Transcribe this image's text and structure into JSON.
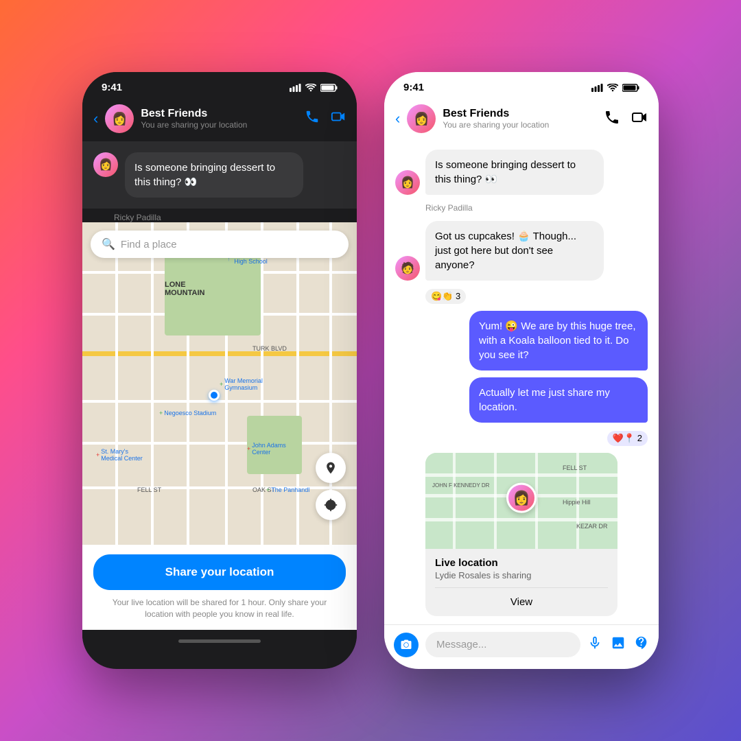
{
  "background": "gradient",
  "left_phone": {
    "status_bar": {
      "time": "9:41",
      "signal": "●●●",
      "wifi": "wifi",
      "battery": "battery"
    },
    "nav": {
      "back_label": "‹",
      "name": "Best Friends",
      "subtitle": "You are sharing your location",
      "call_icon": "phone",
      "video_icon": "video"
    },
    "message": {
      "text": "Is someone bringing dessert to this thing? 👀",
      "sender": "Ricky Padilla"
    },
    "search": {
      "placeholder": "Find a place"
    },
    "share_button": "Share your location",
    "disclaimer": "Your live location will be shared for 1 hour. Only share your location with people you know in real life."
  },
  "right_phone": {
    "status_bar": {
      "time": "9:41"
    },
    "nav": {
      "name": "Best Friends",
      "subtitle": "You are sharing your location"
    },
    "messages": [
      {
        "id": "msg1",
        "type": "received",
        "text": "Is someone bringing dessert to this thing? 👀",
        "sender": "Ricky Padilla",
        "reaction": null
      },
      {
        "id": "msg2",
        "type": "received",
        "text": "Got us cupcakes! 🧁 Though... just got here but don't see anyone?",
        "sender": null,
        "reaction": "😋👏 3"
      },
      {
        "id": "msg3",
        "type": "sent",
        "text": "Yum! 😜 We are by this huge tree, with a Koala balloon tied to it. Do you see it?",
        "reaction": null
      },
      {
        "id": "msg4",
        "type": "sent",
        "text": "Actually let me just share my location.",
        "reaction": "❤️📍 2"
      }
    ],
    "location_card": {
      "title": "Live location",
      "subtitle": "Lydie Rosales is sharing",
      "view_button": "View"
    },
    "message_input": {
      "placeholder": "Message...",
      "camera_icon": "camera",
      "mic_icon": "mic",
      "image_icon": "image",
      "sticker_icon": "sticker"
    }
  }
}
